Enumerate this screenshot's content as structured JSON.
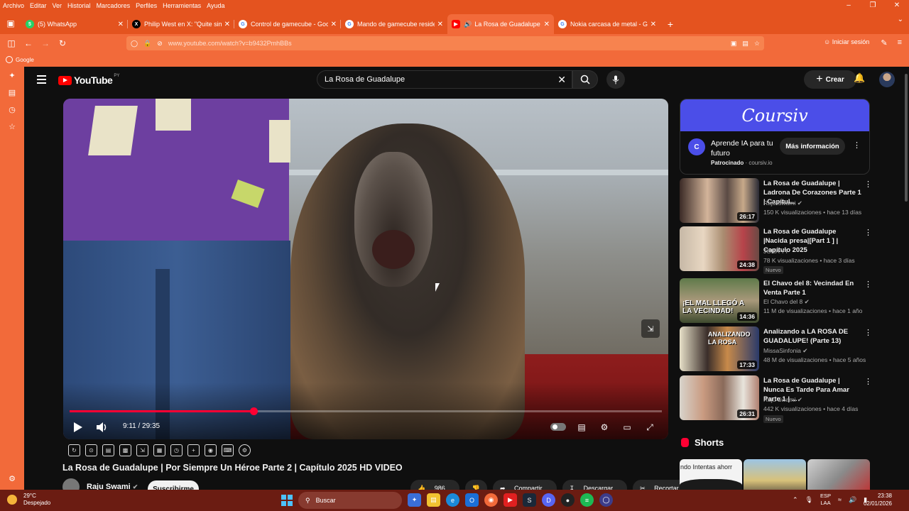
{
  "menubar": {
    "items": [
      "Archivo",
      "Editar",
      "Ver",
      "Historial",
      "Marcadores",
      "Perfiles",
      "Herramientas",
      "Ayuda"
    ]
  },
  "tabs": [
    {
      "label": "(5) WhatsApp",
      "fav_color": "#25d366"
    },
    {
      "label": "Philip West en X: \"Quite simply",
      "fav_color": "#000000"
    },
    {
      "label": "Control de gamecube - Google",
      "fav_color": "#4285f4"
    },
    {
      "label": "Mando de gamecube resident e",
      "fav_color": "#4285f4"
    },
    {
      "label": "La Rosa de Guadalupe | Por",
      "fav_color": "#ff0000"
    },
    {
      "label": "Nokia carcasa de metal - Googl",
      "fav_color": "#4285f4"
    }
  ],
  "address": {
    "url": "www.youtube.com/watch?v=b9432PmhBBs",
    "signin": "Iniciar sesión"
  },
  "bookmarks": {
    "google": "Google"
  },
  "youtube": {
    "logo": "YouTube",
    "country": "PY",
    "search_query": "La Rosa de Guadalupe",
    "create_label": "Crear",
    "player": {
      "time": "9:11 / 29:35",
      "progress": 0.31
    },
    "video_title": "La Rosa de Guadalupe | Por Siempre Un Héroe Parte 2 | Capítulo 2025 HD VIDEO",
    "channel": "Raju Swami",
    "subscribe": "Suscribirme",
    "actions": [
      "986",
      "",
      "Compartir",
      "Descargar",
      "Recortar"
    ]
  },
  "ad": {
    "brand": "Coursiv",
    "logo_letter": "C",
    "text": "Aprende IA para tu futuro",
    "sponsored": "Patrocinado",
    "domain": "coursiv.io",
    "more": "Más información"
  },
  "recommendations": [
    {
      "title": "La Rosa de Guadalupe | Ladrona De Corazones Parte 1 | Capítul...",
      "channel": "Raju Swami",
      "meta": "150 K visualizaciones • hace 13 días",
      "duration": "26:17",
      "badge": ""
    },
    {
      "title": "La Rosa de Guadalupe |Nacida presa|[Part 1 ] | Capítulo 2025",
      "channel": "JORA YT",
      "meta": "78 K visualizaciones • hace 3 días",
      "duration": "24:38",
      "badge": "Nuevo"
    },
    {
      "title": "El Chavo del 8: Vecindad En Venta Parte 1",
      "channel": "El Chavo del 8",
      "meta": "11 M de visualizaciones • hace 1 año",
      "duration": "14:36",
      "badge": "",
      "thumb_text": "¡EL MAL LLEGÓ A LA VECINDAD!"
    },
    {
      "title": "Analizando a LA ROSA DE GUADALUPE! (Parte 13)",
      "channel": "MissaSinfonia",
      "meta": "48 M de visualizaciones • hace 5 años",
      "duration": "17:33",
      "badge": "",
      "thumb_text": "ANALIZANDO LA ROSA"
    },
    {
      "title": "La Rosa de Guadalupe | Nunca Es Tarde Para Amar Parte 1 | ...",
      "channel": "Raju Swami",
      "meta": "442 K visualizaciones • hace 4 días",
      "duration": "26:31",
      "badge": "Nuevo"
    }
  ],
  "shorts": {
    "heading": "Shorts",
    "first_caption": "ndo Intentas ahorr"
  },
  "taskbar": {
    "temp": "29°C",
    "weather": "Despejado",
    "search": "Buscar",
    "lang": "ESP",
    "lang2": "LAA",
    "time": "23:38",
    "date": "02/01/2026"
  }
}
